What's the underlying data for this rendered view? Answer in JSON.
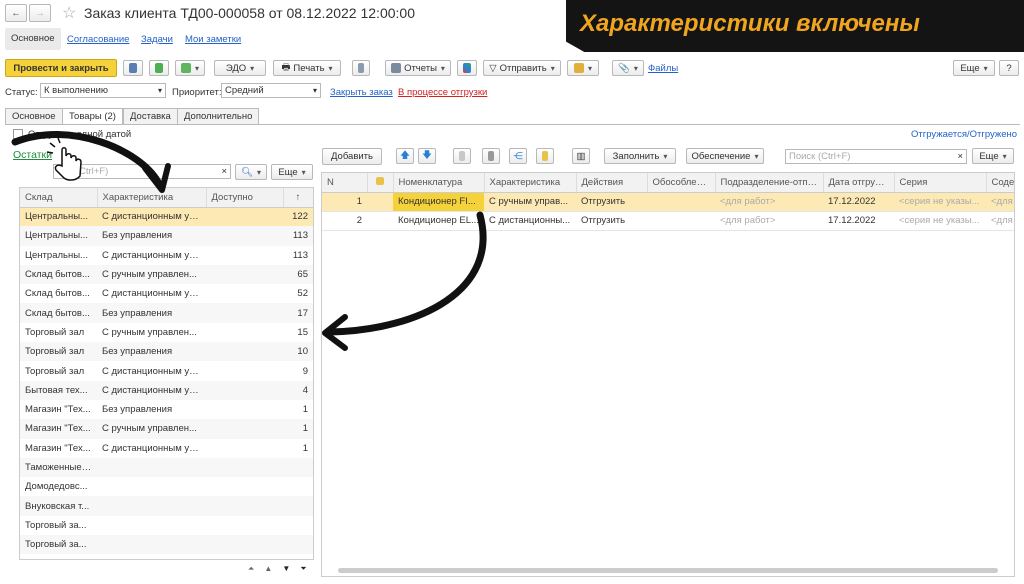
{
  "nav": {
    "back": "←",
    "forward": "→",
    "star": "☆"
  },
  "title": "Заказ клиента ТД00-000058 от 08.12.2022 12:00:00",
  "banner": "Характеристики включены",
  "section_tabs": [
    {
      "label": "Основное"
    },
    {
      "label": "Согласование"
    },
    {
      "label": "Задачи"
    },
    {
      "label": "Мои заметки"
    }
  ],
  "toolbar": {
    "post_close": "Провести и закрыть",
    "edo": "ЭДО",
    "print": "Печать",
    "reports": "Отчеты",
    "send": "Отправить",
    "files": "Файлы",
    "more": "Еще",
    "help": "?"
  },
  "status": {
    "label": "Статус:",
    "value": "К выполнению",
    "priority_label": "Приоритет:",
    "priority_value": "Средний",
    "close_order": "Закрыть заказ",
    "in_shipping": "В процессе отгрузки"
  },
  "form_tabs": [
    {
      "label": "Основное"
    },
    {
      "label": "Товары (2)"
    },
    {
      "label": "Доставка"
    },
    {
      "label": "Дополнительно"
    }
  ],
  "ship_checkbox": "Отгружать одной датой",
  "shipped_link": "Отгружается/Отгружено",
  "stock": {
    "link": "Остатки",
    "search_ph": "Поиск (Ctrl+F)",
    "search_visible": "Ctrl+F)",
    "clear": "×",
    "more": "Еще",
    "headers": [
      "Склад",
      "Характеристика",
      "Доступно",
      "↑"
    ],
    "rows": [
      [
        "Центральны...",
        "С дистанционным уп...",
        "122"
      ],
      [
        "Центральны...",
        "Без управления",
        "113"
      ],
      [
        "Центральны...",
        "С дистанционным уп...",
        "113"
      ],
      [
        "Склад бытов...",
        "С ручным управлен...",
        "65"
      ],
      [
        "Склад бытов...",
        "С дистанционным уп...",
        "52"
      ],
      [
        "Склад бытов...",
        "Без управления",
        "17"
      ],
      [
        "Торговый зал",
        "С ручным управлен...",
        "15"
      ],
      [
        "Торговый зал",
        "Без управления",
        "10"
      ],
      [
        "Торговый зал",
        "С дистанционным уп...",
        "9"
      ],
      [
        "Бытовая тех...",
        "С дистанционным уп...",
        "4"
      ],
      [
        "Магазин \"Тех...",
        "Без управления",
        "1"
      ],
      [
        "Магазин \"Тех...",
        "С ручным управлен...",
        "1"
      ],
      [
        "Магазин \"Тех...",
        "С дистанционным уп...",
        "1"
      ],
      [
        "Таможенные ...",
        "",
        ""
      ],
      [
        "Домодедовс...",
        "",
        ""
      ],
      [
        "Внуковская т...",
        "",
        ""
      ],
      [
        "Торговый за...",
        "",
        ""
      ],
      [
        "Торговый за...",
        "",
        ""
      ]
    ]
  },
  "goods": {
    "add": "Добавить",
    "fill": "Заполнить",
    "supply": "Обеспечение",
    "search_ph": "Поиск (Ctrl+F)",
    "clear": "×",
    "more": "Еще",
    "headers": [
      "N",
      "",
      "Номенклатура",
      "Характеристика",
      "Действия",
      "Обособленно",
      "Подразделение-отпр...",
      "Дата отгрузки",
      "Серия",
      "Соде"
    ],
    "rows": [
      [
        "1",
        "",
        "Кондиционер FI...",
        "С ручным управ...",
        "Отгрузить",
        "",
        "<для работ>",
        "17.12.2022",
        "<серия не указы...",
        "<для"
      ],
      [
        "2",
        "",
        "Кондиционер EL...",
        "С дистанционны...",
        "Отгрузить",
        "",
        "<для работ>",
        "17.12.2022",
        "<серия не указы...",
        "<для"
      ]
    ]
  },
  "colors": {
    "accent_yellow": "#f5d13a",
    "selected_row": "#fce9b4",
    "link": "#2462c8",
    "status_red": "#d32020",
    "banner_bg": "#141414",
    "banner_text": "#f0a51f"
  }
}
